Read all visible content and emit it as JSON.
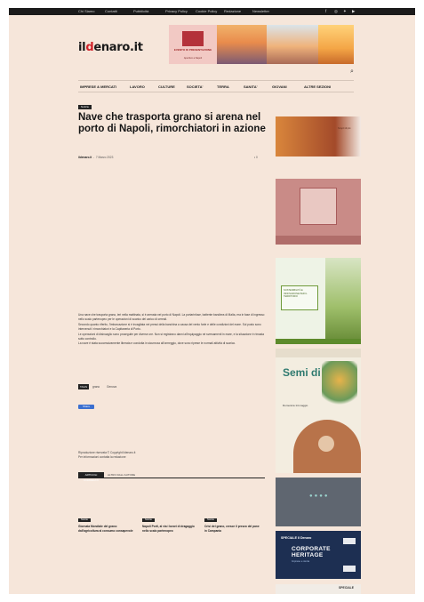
{
  "topbar": {
    "items": [
      "Chi Siamo",
      "Contatti",
      "Pubblicità",
      "Privacy Policy",
      "Cookie Policy",
      "Redazione",
      "Newsletter"
    ],
    "social_icons": [
      "facebook-icon",
      "instagram-icon",
      "twitter-icon",
      "youtube-icon"
    ]
  },
  "header": {
    "logo_main": "il",
    "logo_mark": "d",
    "logo_rest": "enaro.it",
    "ad1_text": "EVENTO DI PRESENTAZIONE",
    "ad1_sub": "Aperitivo a Napoli"
  },
  "nav": {
    "items": [
      "IMPRESE & MERCATI",
      "LAVORO",
      "CULTURE",
      "SOCIETA'",
      "TERRA",
      "SANITA'",
      "GIOVANI",
      "ALTRE SEZIONI"
    ]
  },
  "article": {
    "category": "Notizie",
    "title": "Nave che trasporta grano si arena nel porto di Napoli, rimorchiatori in azione",
    "author": "ildenaro.it",
    "date": "7 Marzo 2023",
    "comments": "0",
    "paragraphs": [
      "Una nave che trasporta grano, ieri nella mattinata, si è arenata nel porto di Napoli. La portarinfuse, battente bandiera di Malta, era in fase di ingresso nello scalo partenopeo per le operazioni di scarico del carico di cereali.",
      "Secondo quanto riferito, l'imbarcazione si è incagliata nei pressi della banchina a causa del vento forte e delle condizioni del mare. Sul posto sono intervenuti i rimorchiatori e la Capitaneria di Porto.",
      "Le operazioni di disincaglio sono proseguite per diverse ore. Non si registrano danni all'equipaggio né sversamenti in mare, e la situazione è rimasta sotto controllo.",
      "La nave è stata successivamente liberata e condotta in sicurezza all'ormeggio, dove sono riprese le normali attività di scarico."
    ],
    "tags_label": "TAGS",
    "tags": [
      "grano",
      "Genova"
    ],
    "share_label": "Share",
    "author_lines": [
      "Riproduzione riservata © Copyright ildenaro.it",
      "Per informazioni contatta la redazione"
    ]
  },
  "related": {
    "tab_active": "ARTICOLI CORRELATI",
    "tab_more": "ALTRO DALL'AUTORE",
    "items": [
      {
        "tag": "Notizie",
        "title": "Giornata Mondiale del grano: dall'agricoltura al consumo consapevole"
      },
      {
        "tag": "Notizie",
        "title": "Napoli Porti, al via i lavori di dragaggio nello scalo partenopeo"
      },
      {
        "tag": "Notizie",
        "title": "Crisi del grano, cresce il prezzo del pane in Campania"
      }
    ]
  },
  "sidebar": {
    "ad1_note": "Scopri di più",
    "ad3_text": "SOSTENIBILITÀ E INNOVAZIONE PER IL TERRITORIO",
    "ad4_big": "Semi di Futuro",
    "ad4_small": "Domenica 14 maggio",
    "ad6_small": "SPECIALE Il Denaro",
    "ad6_title": "CORPORATE HERITAGE",
    "ad6_sub": "Imprese e storia",
    "ad7_text": "SPECIALE"
  }
}
